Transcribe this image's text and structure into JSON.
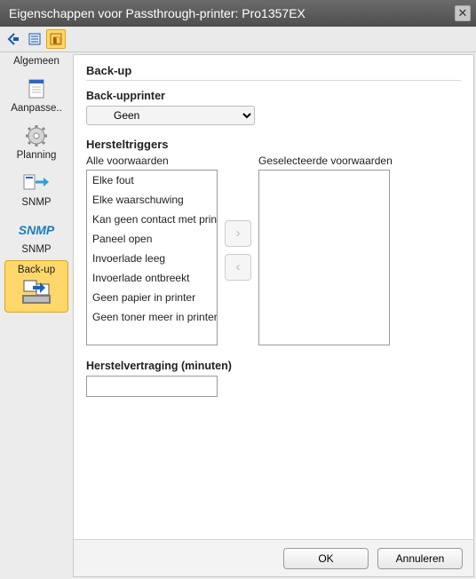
{
  "title": "Eigenschappen voor Passthrough-printer: Pro1357EX",
  "toolbar": {
    "back_icon": "back-icon",
    "list_icon": "list-icon",
    "code_icon": "code-icon"
  },
  "sidebar": {
    "items": [
      {
        "label": "Algemeen"
      },
      {
        "label": "Aanpasse.."
      },
      {
        "label": "Planning"
      },
      {
        "label": "SNMP"
      },
      {
        "label": "SNMP"
      },
      {
        "label": "Back-up"
      }
    ],
    "selected_index": 5
  },
  "page": {
    "heading": "Back-up",
    "printer_label": "Back-upprinter",
    "printer_value": "Geen",
    "triggers_heading": "Hersteltriggers",
    "all_label": "Alle voorwaarden",
    "selected_label": "Geselecteerde voorwaarden",
    "all_items": [
      "Elke fout",
      "Elke waarschuwing",
      "Kan geen contact met printer maken",
      "Paneel open",
      "Invoerlade leeg",
      "Invoerlade ontbreekt",
      "Geen papier in printer",
      "Geen toner meer in printer"
    ],
    "delay_label": "Herstelvertraging (minuten)",
    "delay_value": ""
  },
  "buttons": {
    "ok": "OK",
    "cancel": "Annuleren"
  }
}
